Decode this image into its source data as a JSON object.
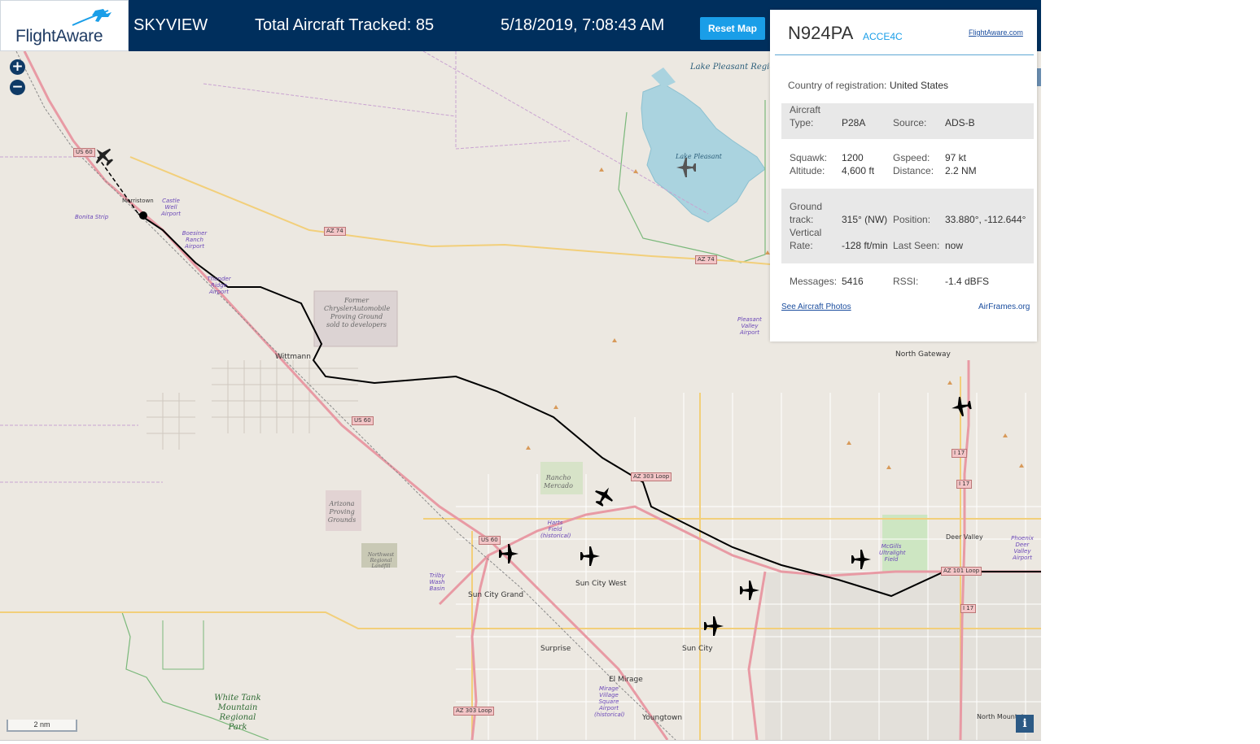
{
  "header": {
    "logo_text": "FlightAware",
    "app_name": "SKYVIEW",
    "total_tracked": "Total Aircraft Tracked: 85",
    "timestamp": "5/18/2019, 7:08:43 AM",
    "reset_label": "Reset Map"
  },
  "map": {
    "zoom_in": "+",
    "zoom_out": "−",
    "scale": "2 nm",
    "info": "i",
    "labels": {
      "lake": "Lake Pleasant Regional Park",
      "lake_pleasant": "Lake Pleasant",
      "former_chrysler": "Former ChryslerAutomobile Proving Ground sold to developers",
      "wittmann": "Wittmann",
      "morristown": "Morristown",
      "castle_well": "Castle Well Airport",
      "boesiner": "Boesiner Ranch Airport",
      "thunder_ridge": "Thunder Ridge Airport",
      "bonita_strip": "Bonita Strip",
      "rancho_mercado": "Rancho Mercado",
      "arizona_proving": "Arizona Proving Grounds",
      "northwest_landfill": "Northwest Regional Landfill",
      "pleasant_valley": "Pleasant Valley Airport",
      "north_gateway": "North Gateway",
      "sun_city_grand": "Sun City Grand",
      "sun_city_west": "Sun City West",
      "sun_city": "Sun City",
      "surprise": "Surprise",
      "el_mirage": "El Mirage",
      "youngtown": "Youngtown",
      "white_tank": "White Tank Mountain Regional Park",
      "deer_valley": "Deer Valley",
      "phoenix_deer_valley": "Phoenix Deer Valley Airport",
      "mcgills": "McGills Ultralight Field",
      "harts_field": "Harts Field (historical)",
      "north_mountain": "North Mountain",
      "mirage_village": "Mirage Village Square Airport (historical)",
      "trilby": "Trilby Wash Basin"
    },
    "road_shields": [
      "US 60",
      "AZ 74",
      "AZ 74",
      "US 60",
      "AZ 303 Loop",
      "US 60",
      "AZ 303 Loop",
      "AZ 101 Loop",
      "I 17",
      "I 17",
      "I 17"
    ]
  },
  "panel": {
    "ident": "N924PA",
    "hex": "ACCE4C",
    "fa_link": "FlightAware.com",
    "country_label": "Country of registration:",
    "country_value": "United States",
    "aircraft_type_label": "Aircraft Type:",
    "aircraft_type_value": "P28A",
    "source_label": "Source:",
    "source_value": "ADS-B",
    "squawk_label": "Squawk:",
    "squawk_value": "1200",
    "altitude_label": "Altitude:",
    "altitude_value": "4,600 ft",
    "gspeed_label": "Gspeed:",
    "gspeed_value": "97 kt",
    "distance_label": "Distance:",
    "distance_value": "2.2 NM",
    "ground_track_label": "Ground track:",
    "ground_track_value": "315° (NW)",
    "position_label": "Position:",
    "position_value": "33.880°, -112.644°",
    "vertical_rate_label": "Vertical Rate:",
    "vertical_rate_value": "-128 ft/min",
    "last_seen_label": "Last Seen:",
    "last_seen_value": "now",
    "messages_label": "Messages:",
    "messages_value": "5416",
    "rssi_label": "RSSI:",
    "rssi_value": "-1.4 dBFS",
    "photos_link": "See Aircraft Photos",
    "airframes_link": "AirFrames.org"
  },
  "colors": {
    "header_bg": "#002f5d",
    "accent": "#1a9ee8",
    "map_bg": "#ece8e1",
    "water": "#aad3df",
    "track": "#000000"
  }
}
